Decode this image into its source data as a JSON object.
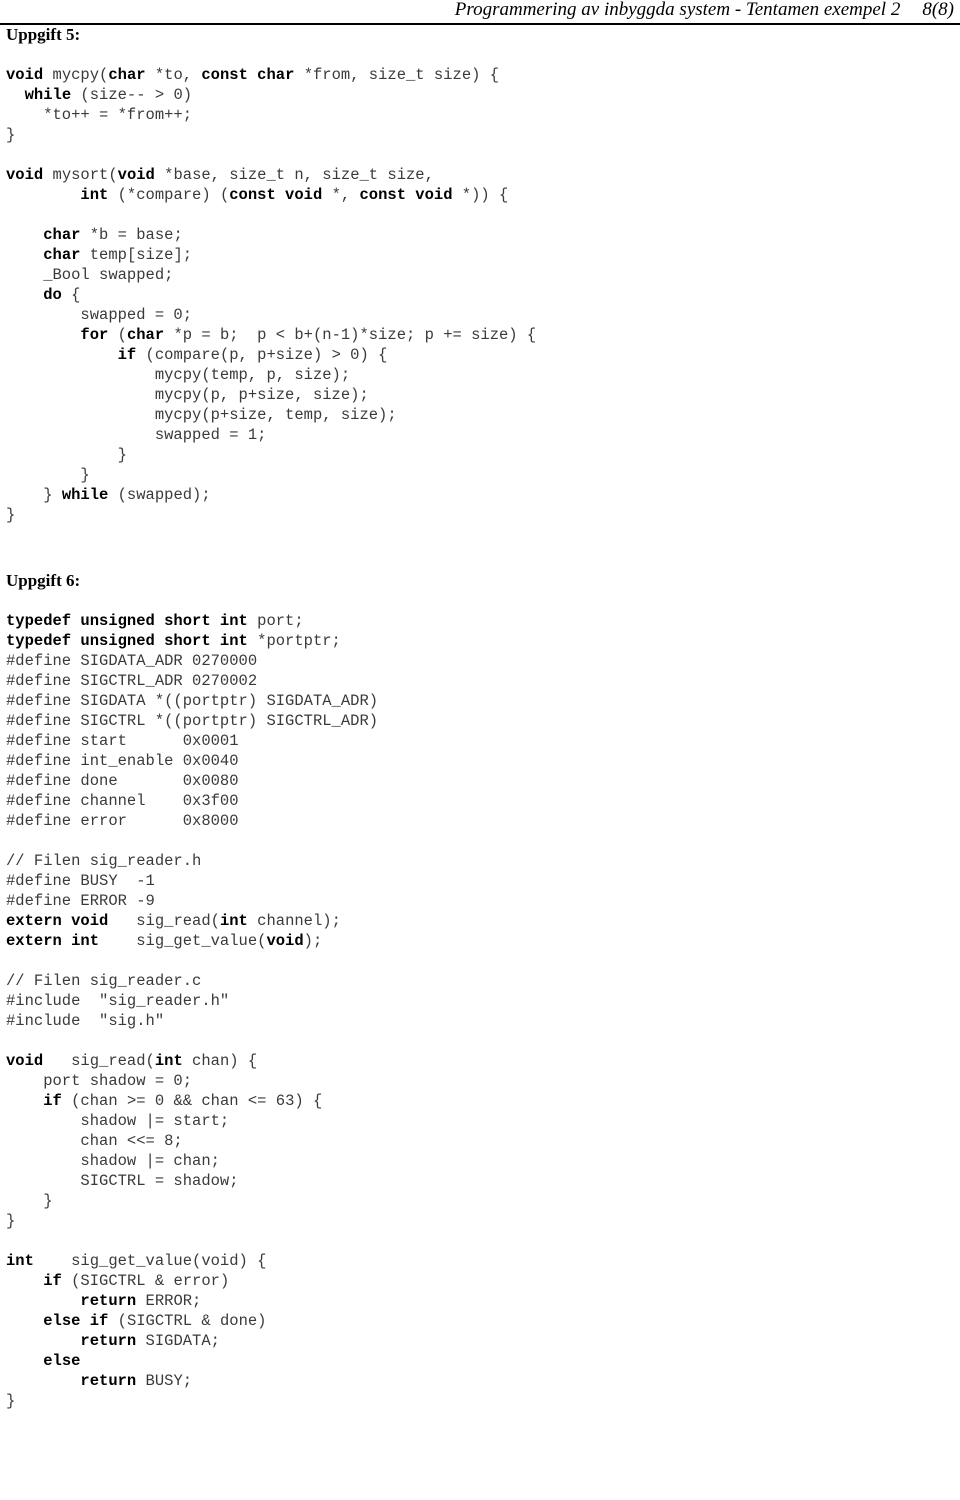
{
  "header": {
    "title": "Programmering av inbyggda system - Tentamen exempel 2",
    "page_number": "8(8)"
  },
  "sections": [
    {
      "heading": "Uppgift 5:",
      "code": [
        [
          {
            "t": "void",
            "b": true
          },
          {
            "t": " mycpy(",
            "b": false
          },
          {
            "t": "char",
            "b": true
          },
          {
            "t": " *to, ",
            "b": false
          },
          {
            "t": "const char",
            "b": true
          },
          {
            "t": " *from, size_t size) {",
            "b": false
          }
        ],
        [
          {
            "t": "  ",
            "b": false
          },
          {
            "t": "while",
            "b": true
          },
          {
            "t": " (size-- > 0)",
            "b": false
          }
        ],
        [
          {
            "t": "    *to++ = *from++;",
            "b": false
          }
        ],
        [
          {
            "t": "}",
            "b": false
          }
        ],
        [
          {
            "t": "",
            "b": false
          }
        ],
        [
          {
            "t": "void",
            "b": true
          },
          {
            "t": " mysort(",
            "b": false
          },
          {
            "t": "void",
            "b": true
          },
          {
            "t": " *base, size_t n, size_t size,",
            "b": false
          }
        ],
        [
          {
            "t": "        ",
            "b": false
          },
          {
            "t": "int",
            "b": true
          },
          {
            "t": " (*compare) (",
            "b": false
          },
          {
            "t": "const void",
            "b": true
          },
          {
            "t": " *, ",
            "b": false
          },
          {
            "t": "const void",
            "b": true
          },
          {
            "t": " *)) {",
            "b": false
          }
        ],
        [
          {
            "t": "",
            "b": false
          }
        ],
        [
          {
            "t": "    ",
            "b": false
          },
          {
            "t": "char",
            "b": true
          },
          {
            "t": " *b = base;",
            "b": false
          }
        ],
        [
          {
            "t": "    ",
            "b": false
          },
          {
            "t": "char",
            "b": true
          },
          {
            "t": " temp[size];",
            "b": false
          }
        ],
        [
          {
            "t": "    _Bool swapped;",
            "b": false
          }
        ],
        [
          {
            "t": "    ",
            "b": false
          },
          {
            "t": "do",
            "b": true
          },
          {
            "t": " {",
            "b": false
          }
        ],
        [
          {
            "t": "        swapped = 0;",
            "b": false
          }
        ],
        [
          {
            "t": "        ",
            "b": false
          },
          {
            "t": "for",
            "b": true
          },
          {
            "t": " (",
            "b": false
          },
          {
            "t": "char",
            "b": true
          },
          {
            "t": " *p = b;  p < b+(n-1)*size; p += size) {",
            "b": false
          }
        ],
        [
          {
            "t": "            ",
            "b": false
          },
          {
            "t": "if",
            "b": true
          },
          {
            "t": " (compare(p, p+size) > 0) {",
            "b": false
          }
        ],
        [
          {
            "t": "                mycpy(temp, p, size);",
            "b": false
          }
        ],
        [
          {
            "t": "                mycpy(p, p+size, size);",
            "b": false
          }
        ],
        [
          {
            "t": "                mycpy(p+size, temp, size);",
            "b": false
          }
        ],
        [
          {
            "t": "                swapped = 1;",
            "b": false
          }
        ],
        [
          {
            "t": "            }",
            "b": false
          }
        ],
        [
          {
            "t": "        }",
            "b": false
          }
        ],
        [
          {
            "t": "    } ",
            "b": false
          },
          {
            "t": "while",
            "b": true
          },
          {
            "t": " (swapped);",
            "b": false
          }
        ],
        [
          {
            "t": "}",
            "b": false
          }
        ]
      ]
    },
    {
      "heading": "Uppgift 6:",
      "code": [
        [
          {
            "t": "typedef unsigned short int",
            "b": true
          },
          {
            "t": " port;",
            "b": false
          }
        ],
        [
          {
            "t": "typedef unsigned short int",
            "b": true
          },
          {
            "t": " *portptr;",
            "b": false
          }
        ],
        [
          {
            "t": "#define SIGDATA_ADR 0270000",
            "b": false
          }
        ],
        [
          {
            "t": "#define SIGCTRL_ADR 0270002",
            "b": false
          }
        ],
        [
          {
            "t": "#define SIGDATA *((portptr) SIGDATA_ADR)",
            "b": false
          }
        ],
        [
          {
            "t": "#define SIGCTRL *((portptr) SIGCTRL_ADR)",
            "b": false
          }
        ],
        [
          {
            "t": "#define start      0x0001",
            "b": false
          }
        ],
        [
          {
            "t": "#define int_enable 0x0040",
            "b": false
          }
        ],
        [
          {
            "t": "#define done       0x0080",
            "b": false
          }
        ],
        [
          {
            "t": "#define channel    0x3f00",
            "b": false
          }
        ],
        [
          {
            "t": "#define error      0x8000",
            "b": false
          }
        ],
        [
          {
            "t": "",
            "b": false
          }
        ],
        [
          {
            "t": "// Filen sig_reader.h",
            "b": false
          }
        ],
        [
          {
            "t": "#define BUSY  -1",
            "b": false
          }
        ],
        [
          {
            "t": "#define ERROR -9",
            "b": false
          }
        ],
        [
          {
            "t": "extern void",
            "b": true
          },
          {
            "t": "   sig_read(",
            "b": false
          },
          {
            "t": "int",
            "b": true
          },
          {
            "t": " channel);",
            "b": false
          }
        ],
        [
          {
            "t": "extern int",
            "b": true
          },
          {
            "t": "    sig_get_value(",
            "b": false
          },
          {
            "t": "void",
            "b": true
          },
          {
            "t": ");",
            "b": false
          }
        ],
        [
          {
            "t": "",
            "b": false
          }
        ],
        [
          {
            "t": "// Filen sig_reader.c",
            "b": false
          }
        ],
        [
          {
            "t": "#include  \"sig_reader.h\"",
            "b": false
          }
        ],
        [
          {
            "t": "#include  \"sig.h\"",
            "b": false
          }
        ],
        [
          {
            "t": "",
            "b": false
          }
        ],
        [
          {
            "t": "void",
            "b": true
          },
          {
            "t": "   sig_read(",
            "b": false
          },
          {
            "t": "int",
            "b": true
          },
          {
            "t": " chan) {",
            "b": false
          }
        ],
        [
          {
            "t": "    port shadow = 0;",
            "b": false
          }
        ],
        [
          {
            "t": "    ",
            "b": false
          },
          {
            "t": "if",
            "b": true
          },
          {
            "t": " (chan >= 0 && chan <= 63) {",
            "b": false
          }
        ],
        [
          {
            "t": "        shadow |= start;",
            "b": false
          }
        ],
        [
          {
            "t": "        chan <<= 8;",
            "b": false
          }
        ],
        [
          {
            "t": "        shadow |= chan;",
            "b": false
          }
        ],
        [
          {
            "t": "        SIGCTRL = shadow;",
            "b": false
          }
        ],
        [
          {
            "t": "    }",
            "b": false
          }
        ],
        [
          {
            "t": "}",
            "b": false
          }
        ],
        [
          {
            "t": "",
            "b": false
          }
        ],
        [
          {
            "t": "int",
            "b": true
          },
          {
            "t": "    sig_get_value(void) {",
            "b": false
          }
        ],
        [
          {
            "t": "    ",
            "b": false
          },
          {
            "t": "if",
            "b": true
          },
          {
            "t": " (SIGCTRL & error)",
            "b": false
          }
        ],
        [
          {
            "t": "        ",
            "b": false
          },
          {
            "t": "return",
            "b": true
          },
          {
            "t": " ERROR;",
            "b": false
          }
        ],
        [
          {
            "t": "    ",
            "b": false
          },
          {
            "t": "else if",
            "b": true
          },
          {
            "t": " (SIGCTRL & done)",
            "b": false
          }
        ],
        [
          {
            "t": "        ",
            "b": false
          },
          {
            "t": "return",
            "b": true
          },
          {
            "t": " SIGDATA;",
            "b": false
          }
        ],
        [
          {
            "t": "    ",
            "b": false
          },
          {
            "t": "else",
            "b": true
          }
        ],
        [
          {
            "t": "        ",
            "b": false
          },
          {
            "t": "return",
            "b": true
          },
          {
            "t": " BUSY;",
            "b": false
          }
        ],
        [
          {
            "t": "}",
            "b": false
          }
        ]
      ]
    }
  ]
}
